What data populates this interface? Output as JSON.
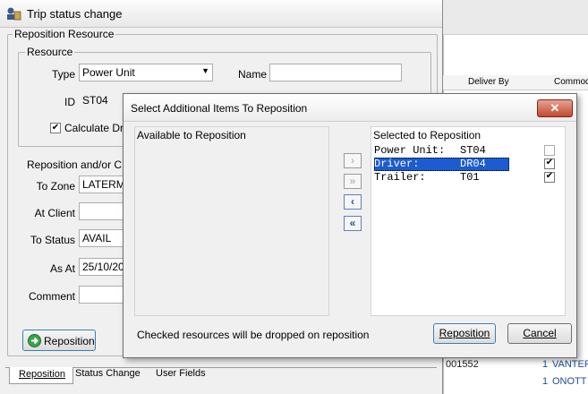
{
  "background_grid": {
    "header_deliver_by": "Deliver By",
    "header_commodity": "Commodi",
    "rows": [
      {
        "id": "001552",
        "num": "1",
        "name": "VANTER"
      },
      {
        "id": "",
        "num": "1",
        "name": "ONOTT"
      }
    ]
  },
  "window": {
    "title": "Trip status change"
  },
  "reposition_resource": {
    "group_label": "Reposition Resource",
    "resource_label": "Resource",
    "type_label": "Type",
    "type_value": "Power Unit",
    "name_label": "Name",
    "name_value": "",
    "id_label": "ID",
    "id_value": "ST04",
    "calculate_label": "Calculate Dr",
    "calculate_checked": true,
    "reposition_client_label": "Reposition and/or C",
    "to_zone_label": "To Zone",
    "to_zone_value": "LATERM",
    "at_client_label": "At Client",
    "at_client_value": "",
    "to_status_label": "To Status",
    "to_status_value": "AVAIL",
    "as_at_label": "As At",
    "as_at_value": "25/10/20",
    "comment_label": "Comment",
    "comment_value": "",
    "reposition_button": "Reposition"
  },
  "tabs": [
    "Reposition",
    "Status Change",
    "User Fields"
  ],
  "dialog": {
    "title": "Select Additional Items To Reposition",
    "available_label": "Available to Reposition",
    "selected_label": "Selected to Reposition",
    "selected_items": [
      {
        "type": "Power Unit:",
        "code": "ST04",
        "checked": false
      },
      {
        "type": "Driver:",
        "code": "DR04",
        "checked": true
      },
      {
        "type": "Trailer:",
        "code": "T01",
        "checked": true
      }
    ],
    "footer_note": "Checked resources will be dropped on reposition",
    "reposition_button": "Reposition",
    "cancel_button": "Cancel",
    "close_glyph": "✕"
  }
}
